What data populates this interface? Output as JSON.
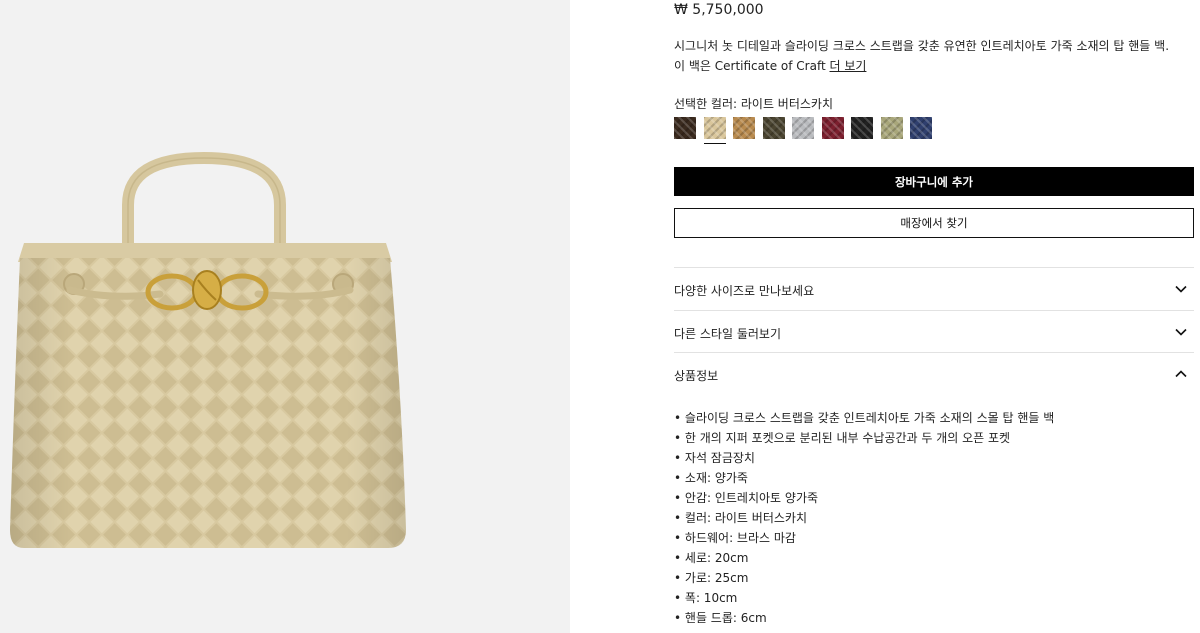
{
  "product": {
    "price": "₩ 5,750,000",
    "description_line1": "시그니처 놋 디테일과 슬라이딩 크로스 스트랩을 갖춘 유연한 인트레치아토 가죽 소재의 탑 핸들 백.",
    "description_line2_prefix": "이 백은 Certificate of Craft",
    "description_link": "더 보기"
  },
  "color": {
    "label": "선택한 컬러: 라이트 버터스카치",
    "swatches": [
      {
        "name": "dark-brown",
        "hex": "#3a2a1e"
      },
      {
        "name": "light-butterscotch",
        "hex": "#d9c69b",
        "selected": true
      },
      {
        "name": "tan",
        "hex": "#b88a4e"
      },
      {
        "name": "olive-dark",
        "hex": "#4a4430"
      },
      {
        "name": "grey",
        "hex": "#b9bbbe"
      },
      {
        "name": "burgundy",
        "hex": "#7c1f2e"
      },
      {
        "name": "black",
        "hex": "#222222"
      },
      {
        "name": "sage",
        "hex": "#a8a67a"
      },
      {
        "name": "navy",
        "hex": "#2f3f6e"
      }
    ]
  },
  "buttons": {
    "add_to_cart": "장바구니에 추가",
    "find_in_store": "매장에서 찾기"
  },
  "accordions": [
    {
      "label": "다양한 사이즈로 만나보세요",
      "icon": "chevron-down-icon"
    },
    {
      "label": "다른 스타일 둘러보기",
      "icon": "chevron-down-icon"
    },
    {
      "label": "상품정보",
      "icon": "chevron-up-icon"
    }
  ],
  "details": [
    "슬라이딩 크로스 스트랩을 갖춘 인트레치아토 가죽 소재의 스몰 탑 핸들 백",
    "한 개의 지퍼 포켓으로 분리된 내부 수납공간과 두 개의 오픈 포켓",
    "자석 잠금장치",
    "소재: 양가죽",
    "안감: 인트레치아토 양가죽",
    "컬러: 라이트 버터스카치",
    "하드웨어: 브라스 마감",
    "세로: 20cm",
    "가로: 25cm",
    "폭: 10cm",
    "핸들 드롭: 6cm"
  ]
}
